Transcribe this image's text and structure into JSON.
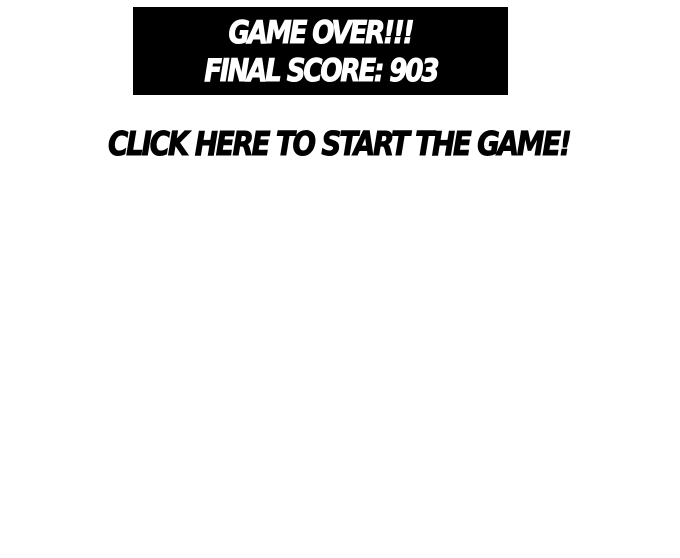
{
  "gameover": {
    "title": "GAME OVER!!!",
    "final_score_text": "FINAL SCORE: 903",
    "final_score_value": 903
  },
  "start": {
    "link_text": "CLICK HERE TO START THE GAME!"
  },
  "colors": {
    "background": "#ffffff",
    "panel": "#000000",
    "panel_text": "#ffffff",
    "link_text": "#000000"
  }
}
